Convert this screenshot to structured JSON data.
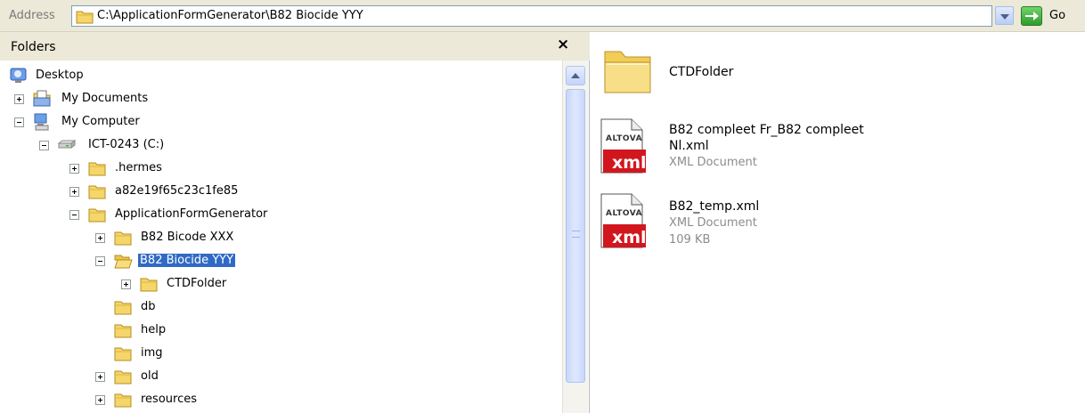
{
  "address_bar": {
    "label": "Address",
    "path": "C:\\ApplicationFormGenerator\\B82 Biocide YYY",
    "go_label": "Go"
  },
  "folders_pane": {
    "title": "Folders",
    "close_glyph": "×",
    "tree": [
      {
        "label": "Desktop",
        "icon": "desktop-icon"
      },
      {
        "label": "My Documents",
        "icon": "documents-icon",
        "expander": "plus"
      },
      {
        "label": "My Computer",
        "icon": "computer-icon",
        "expander": "minus"
      },
      {
        "label": "ICT-0243 (C:)",
        "icon": "drive-icon",
        "expander": "minus"
      },
      {
        "label": ".hermes",
        "icon": "folder-icon",
        "expander": "plus"
      },
      {
        "label": "a82e19f65c23c1fe85",
        "icon": "folder-icon",
        "expander": "plus"
      },
      {
        "label": "ApplicationFormGenerator",
        "icon": "folder-icon",
        "expander": "minus"
      },
      {
        "label": "B82 Bicode XXX",
        "icon": "folder-icon",
        "expander": "plus"
      },
      {
        "label": "B82 Biocide YYY",
        "icon": "open-folder-icon",
        "expander": "minus",
        "selected": true
      },
      {
        "label": "CTDFolder",
        "icon": "folder-icon",
        "expander": "plus"
      },
      {
        "label": "db",
        "icon": "folder-icon"
      },
      {
        "label": "help",
        "icon": "folder-icon"
      },
      {
        "label": "img",
        "icon": "folder-icon"
      },
      {
        "label": "old",
        "icon": "folder-icon",
        "expander": "plus"
      },
      {
        "label": "resources",
        "icon": "folder-icon",
        "expander": "plus"
      }
    ]
  },
  "files": [
    {
      "name": "CTDFolder",
      "icon": "large-folder-icon"
    },
    {
      "name_line1": "B82 compleet Fr_B82 compleet",
      "name_line2": "Nl.xml",
      "type": "XML Document",
      "icon": "altova-xml-icon",
      "icon_brand": "ALTOVA",
      "icon_text": "xml"
    },
    {
      "name": "B82_temp.xml",
      "type": "XML Document",
      "size": "109 KB",
      "icon": "altova-xml-icon",
      "icon_brand": "ALTOVA",
      "icon_text": "xml"
    }
  ],
  "colors": {
    "selection": "#316ac5",
    "folder_yellow": "#f5d66b",
    "xml_red": "#d2161e",
    "toolbar_bg": "#ece9d8"
  }
}
